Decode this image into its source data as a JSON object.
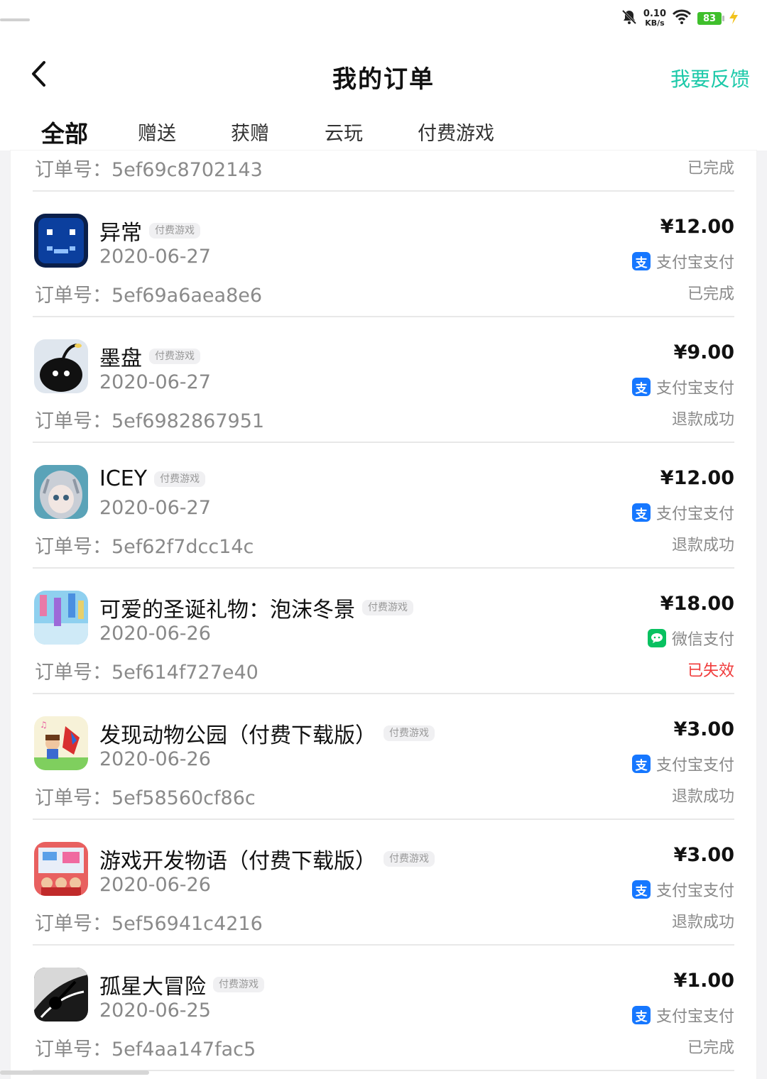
{
  "status_bar": {
    "net_speed_value": "0.10",
    "net_speed_unit": "KB/s",
    "battery": "83",
    "icons": [
      "mute-bell-icon",
      "wifi-icon",
      "battery-icon",
      "charging-icon"
    ]
  },
  "header": {
    "title": "我的订单",
    "feedback": "我要反馈",
    "back_icon": "chevron-left-icon"
  },
  "tabs": [
    "全部",
    "赠送",
    "获赠",
    "云玩",
    "付费游戏"
  ],
  "active_tab": "全部",
  "colors": {
    "accent": "#1cc9a9",
    "tab_underline": "#1fd6b4",
    "alipay": "#1677ff",
    "wechat": "#08c160",
    "failed": "#f03a3a"
  },
  "top_order": {
    "order_label": "订单号：",
    "order_no": "5ef69c8702143",
    "status": "已完成"
  },
  "orders": [
    {
      "name": "异常",
      "tag": "付费游戏",
      "date": "2020-06-27",
      "order_label": "订单号：",
      "order_no": "5ef69a6aea8e6",
      "price": "¥12.00",
      "pay_method": "支付宝支付",
      "pay_icon": "支",
      "status": "已完成"
    },
    {
      "name": "墨盘",
      "tag": "付费游戏",
      "date": "2020-06-27",
      "order_label": "订单号：",
      "order_no": "5ef6982867951",
      "price": "¥9.00",
      "pay_method": "支付宝支付",
      "pay_icon": "支",
      "status": "退款成功"
    },
    {
      "name": "ICEY",
      "tag": "付费游戏",
      "date": "2020-06-27",
      "order_label": "订单号：",
      "order_no": "5ef62f7dcc14c",
      "price": "¥12.00",
      "pay_method": "支付宝支付",
      "pay_icon": "支",
      "status": "退款成功"
    },
    {
      "name": "可爱的圣诞礼物：泡沫冬景",
      "tag": "付费游戏",
      "date": "2020-06-26",
      "order_label": "订单号：",
      "order_no": "5ef614f727e40",
      "price": "¥18.00",
      "pay_method": "微信支付",
      "pay_icon": "💬",
      "status": "已失效"
    },
    {
      "name": "发现动物公园（付费下载版）",
      "tag": "付费游戏",
      "date": "2020-06-26",
      "order_label": "订单号：",
      "order_no": "5ef58560cf86c",
      "price": "¥3.00",
      "pay_method": "支付宝支付",
      "pay_icon": "支",
      "status": "退款成功"
    },
    {
      "name": "游戏开发物语（付费下载版）",
      "tag": "付费游戏",
      "date": "2020-06-26",
      "order_label": "订单号：",
      "order_no": "5ef56941c4216",
      "price": "¥3.00",
      "pay_method": "支付宝支付",
      "pay_icon": "支",
      "status": "退款成功"
    },
    {
      "name": "孤星大冒险",
      "tag": "付费游戏",
      "date": "2020-06-25",
      "order_label": "订单号：",
      "order_no": "5ef4aa147fac5",
      "price": "¥1.00",
      "pay_method": "支付宝支付",
      "pay_icon": "支",
      "status": "已完成"
    }
  ]
}
